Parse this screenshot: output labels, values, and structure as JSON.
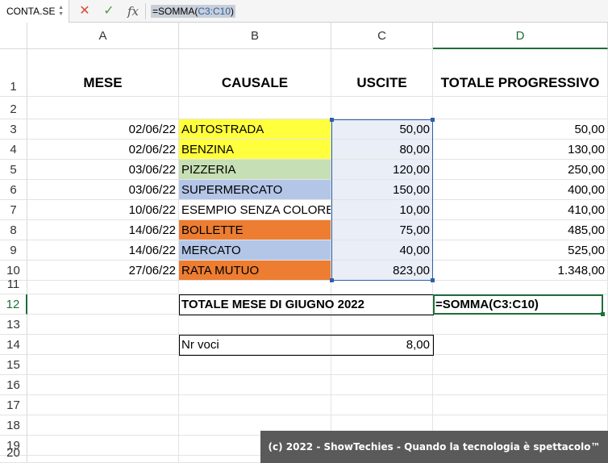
{
  "formula_bar": {
    "name_box": "CONTA.SE",
    "cancel_icon": "✕",
    "enter_icon": "✓",
    "fx_label": "fx",
    "formula_prefix": "=SOMMA(",
    "formula_ref": "C3:C10",
    "formula_suffix": ")"
  },
  "columns": [
    "A",
    "B",
    "C",
    "D"
  ],
  "rows": [
    "1",
    "2",
    "3",
    "4",
    "5",
    "6",
    "7",
    "8",
    "9",
    "10",
    "11",
    "12",
    "13",
    "14",
    "15",
    "16",
    "17",
    "18",
    "19",
    "20"
  ],
  "headers": {
    "mese": "MESE",
    "causale": "CAUSALE",
    "uscite": "USCITE",
    "totale_progressivo": "TOTALE PROGRESSIVO"
  },
  "entries": [
    {
      "date": "02/06/22",
      "causale": "AUTOSTRADA",
      "uscite": "50,00",
      "progressivo": "50,00",
      "color": "#ffff3d"
    },
    {
      "date": "02/06/22",
      "causale": "BENZINA",
      "uscite": "80,00",
      "progressivo": "130,00",
      "color": "#ffff3d"
    },
    {
      "date": "03/06/22",
      "causale": "PIZZERIA",
      "uscite": "120,00",
      "progressivo": "250,00",
      "color": "#c6dfb4"
    },
    {
      "date": "03/06/22",
      "causale": "SUPERMERCATO",
      "uscite": "150,00",
      "progressivo": "400,00",
      "color": "#b4c6e7"
    },
    {
      "date": "10/06/22",
      "causale": "ESEMPIO SENZA COLORE",
      "uscite": "10,00",
      "progressivo": "410,00",
      "color": "#ffffff"
    },
    {
      "date": "14/06/22",
      "causale": "BOLLETTE",
      "uscite": "75,00",
      "progressivo": "485,00",
      "color": "#ed7d31"
    },
    {
      "date": "14/06/22",
      "causale": "MERCATO",
      "uscite": "40,00",
      "progressivo": "525,00",
      "color": "#b4c6e7"
    },
    {
      "date": "27/06/22",
      "causale": "RATA MUTUO",
      "uscite": "823,00",
      "progressivo": "1.348,00",
      "color": "#ed7d31"
    }
  ],
  "totale": {
    "label": "TOTALE MESE DI GIUGNO 2022",
    "formula": "=SOMMA(C3:C10)"
  },
  "nr_voci": {
    "label": "Nr voci",
    "value": "8,00"
  },
  "watermark": "(c) 2022 - ShowTechies - Quando la tecnologia è spettacolo™",
  "colors": {
    "selection": "#2f5ea8",
    "selection_fill": "#e9eef7",
    "active": "#1e6e3a"
  }
}
